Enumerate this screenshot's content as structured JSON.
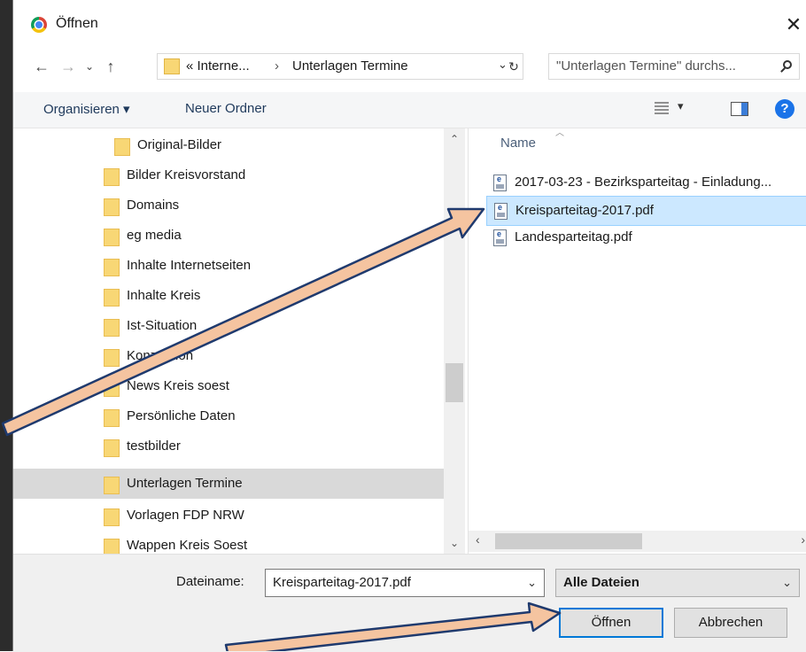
{
  "title": "Öffnen",
  "address": {
    "crumbs": [
      "«  Interne...",
      "›",
      "Unterlagen Termine"
    ]
  },
  "search": {
    "placeholder": "\"Unterlagen Termine\" durchs..."
  },
  "toolbar": {
    "organize": "Organisieren ▾",
    "new_folder": "Neuer Ordner"
  },
  "tree": {
    "items": [
      {
        "label": "Original-Bilder"
      },
      {
        "label": "Bilder Kreisvorstand"
      },
      {
        "label": "Domains"
      },
      {
        "label": "eg media"
      },
      {
        "label": "Inhalte Internetseiten"
      },
      {
        "label": "Inhalte Kreis"
      },
      {
        "label": "Ist-Situation"
      },
      {
        "label": "Konzeption"
      },
      {
        "label": "News Kreis soest"
      },
      {
        "label": "Persönliche Daten"
      },
      {
        "label": "testbilder"
      },
      {
        "label": "Unterlagen Termine"
      },
      {
        "label": "Vorlagen FDP NRW"
      },
      {
        "label": "Wappen Kreis Soest"
      }
    ]
  },
  "files": {
    "column_header": "Name",
    "items": [
      {
        "label": "2017-03-23 - Bezirksparteitag - Einladung..."
      },
      {
        "label": "Kreisparteitag-2017.pdf"
      },
      {
        "label": "Landesparteitag.pdf"
      }
    ]
  },
  "bottom": {
    "filename_label": "Dateiname:",
    "filename_value": "Kreisparteitag-2017.pdf",
    "filetype_value": "Alle Dateien",
    "open_label": "Öffnen",
    "cancel_label": "Abbrechen"
  },
  "colors": {
    "selection": "#cce8ff",
    "accent": "#0078d7",
    "arrow_fill": "#f5c4a0",
    "arrow_stroke": "#1f3a6e"
  },
  "icons": [
    "chrome-icon",
    "close-icon",
    "back-arrow-icon",
    "forward-arrow-icon",
    "up-arrow-icon",
    "folder-icon",
    "refresh-icon",
    "search-icon",
    "view-options-icon",
    "preview-pane-icon",
    "help-icon",
    "pdf-file-icon"
  ]
}
